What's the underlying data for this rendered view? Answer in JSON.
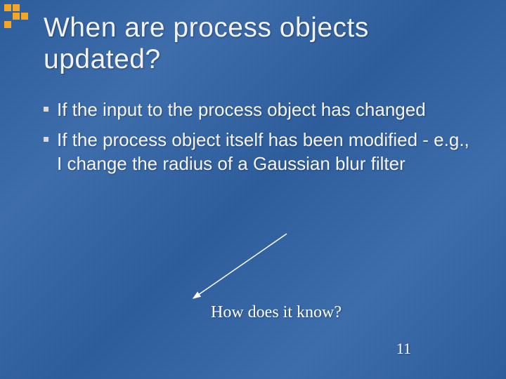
{
  "title": "When are process objects updated?",
  "bullets": [
    "If the input to the process object has changed",
    "If the process object itself has been modified - e.g., I change the radius of a Gaussian blur filter"
  ],
  "annotation": "How does it know?",
  "page_number": "11"
}
